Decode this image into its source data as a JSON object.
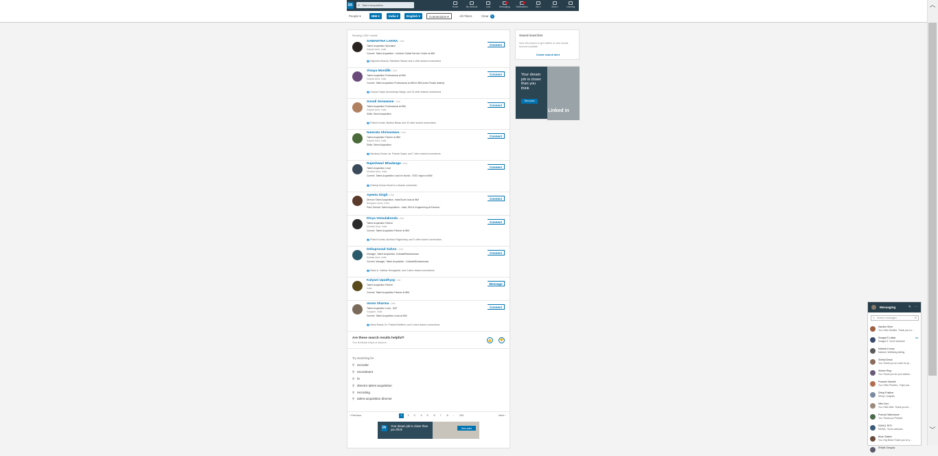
{
  "nav": {
    "logo": "in",
    "search_value": "Talent Acquisition",
    "items": [
      {
        "label": "Home",
        "icon": "home-icon"
      },
      {
        "label": "My Network",
        "icon": "network-icon"
      },
      {
        "label": "Jobs",
        "icon": "jobs-icon"
      },
      {
        "label": "Messaging",
        "icon": "messaging-icon"
      },
      {
        "label": "Notifications",
        "icon": "bell-icon"
      },
      {
        "label": "Me ▾",
        "icon": "avatar-icon"
      },
      {
        "label": "Work ▾",
        "icon": "grid-icon"
      },
      {
        "label": "Learning",
        "icon": "learning-icon"
      }
    ]
  },
  "filters": {
    "people": "People ▾",
    "company": "IBM ▾",
    "location": "India ▾",
    "language": "English ▾",
    "connections": "Connections ▾",
    "all_filters": "All Filters",
    "clear": "Clear",
    "clear_count": "3"
  },
  "results": {
    "showing": "Showing 1,000+ results",
    "items": [
      {
        "name": "SAMANTHA LAKRA",
        "degree": "• 2nd",
        "l1": "Talent Acquisition Specialist",
        "l2": "Kalyani Area, India",
        "l3": "Current: Talent Acquisition - Infotech Global Service Center at IBM",
        "shared": "Rajendra Dhanuk, Rishikesh Rawat, and 4 other shared connections",
        "action": "Connect"
      },
      {
        "name": "Vinaya Mondlik",
        "degree": "• 2nd",
        "l1": "Talent Acquisition Professional at IBM",
        "l2": "Kalyani Area, India",
        "l3": "Current: Talent Acquisition Professional at IBM in IBM (India Private limited)",
        "shared": "Gaurav Gupta, Anushreeya Sahgu, and 14 other shared connections",
        "action": "Connect"
      },
      {
        "name": "Sonali Sonawane",
        "degree": "• 2nd",
        "l1": "Talent Acquisition Professional at IBM",
        "l2": "Kalyani Area, India",
        "l3": "Skills: Talent Acquisition",
        "shared": "Pritesh Kumar, Madhur Bhata, and 30 other shared connections",
        "action": "Connect"
      },
      {
        "name": "Namrata Shrivastava",
        "degree": "• 2nd",
        "l1": "Talent Acquisition Partner at IBM",
        "l2": "Kalyani Area, India",
        "l3": "Skills: Talent Acquisition",
        "shared": "Sandeep Kumar Lal, Pranab Gupta, and 7 other shared connections",
        "action": "Connect"
      },
      {
        "name": "Rajeshwari Bhadange",
        "degree": "• 2nd",
        "l1": "Talent Acquisition Lead",
        "l2": "Mumbai Area, India",
        "l3": "Current: Talent Acquisition Lead for Nordic - ISSC region at IBM",
        "shared": "Dheeraj Kumar Keshri is a shared connection",
        "action": "Connect"
      },
      {
        "name": "Apeeta Singh",
        "degree": "• 2nd",
        "l1": "Director Talent Acquisition, India/South Asia at IBM",
        "l2": "Bengaluru Area, India",
        "l3": "Past: Director Talent Acquisition - India, SEA & Engineering at Ericsson",
        "shared": "",
        "action": "Connect"
      },
      {
        "name": "Divya Vemulakonda",
        "degree": "• 2nd",
        "l1": "Talent Acquisition Partner",
        "l2": "Mumbai Area, India",
        "l3": "Current: Talent Acquisition Partner at IBM",
        "shared": "Pritesh Kumar, Anubhav Rajpurohay, and 9 other shared connections",
        "action": "Connect"
      },
      {
        "name": "Debaprasad Sahoo",
        "degree": "• 2nd",
        "l1": "Manager, Talent Acquisition, Kolkata/Bhubaneswar",
        "l2": "Kolkata Area, India",
        "l3": "Current: Manager, Talent Acquisition - Kolkata/Bhubaneswar",
        "shared": "Rahul A. Vaibhav Nimagadde, and 4 other shared connections",
        "action": "Connect"
      },
      {
        "name": "Kalyani Upadhyay",
        "degree": "• 1st",
        "l1": "Talent Acquisition Partner",
        "l2": "India",
        "l3": "Current: Talent Acquisition Partner at IBM",
        "shared": "",
        "action": "Message"
      },
      {
        "name": "Varun Sharma",
        "degree": "• 2nd",
        "l1": "Talent Acquisition Lead - SAP",
        "l2": "Gurgaon, India",
        "l3": "Current: Talent Acquisition Lead at IBM",
        "shared": "Nisha Rawal, Dr. Prakshit Bahlhmi, and 4 other shared connections",
        "action": "Connect"
      }
    ]
  },
  "helpful": {
    "question": "Are these search results helpful?",
    "subtitle": "Your feedback helps us improve.",
    "thumb_up": "👍",
    "thumb_down": "👎"
  },
  "try_searching": {
    "title": "Try searching for",
    "items": [
      "recruiter",
      "recruitment",
      "hr",
      "director talent acquisition",
      "recruiting",
      "talent acquisition director"
    ]
  },
  "pagination": {
    "previous": "‹ Previous",
    "next": "Next ›",
    "pages": [
      "1",
      "2",
      "3",
      "4",
      "5",
      "6",
      "7",
      "8",
      "…",
      "100"
    ],
    "current": "1"
  },
  "bottom_ad": {
    "logo": "in",
    "text": "Your dream job is closer than you think",
    "button": "See jobs"
  },
  "saved_searches": {
    "title": "Saved searches",
    "description": "Save this search to get notified on new results become available",
    "link": "Create search alert"
  },
  "right_ad": {
    "text": "Your dream job is closer than you think",
    "button": "See jobs",
    "brand": "Linked in"
  },
  "messaging": {
    "title": "Messaging",
    "search_placeholder": "Search messages",
    "conversations": [
      {
        "name": "Sandhe Sheri",
        "preview": "You: Hello Sandhe. Thank you so…",
        "date": ""
      },
      {
        "name": "Swagat S Lalkar",
        "preview": "Swagat S: You're welcome",
        "date": "4/1"
      },
      {
        "name": "Mahesh Kumar",
        "preview": "Mahesh: Wellbeing sibling",
        "date": ""
      },
      {
        "name": "Shilhal Desai",
        "preview": "You: Thank you so much for yo…",
        "date": ""
      },
      {
        "name": "Shirlee Ring",
        "preview": "You: Thank you for your wishes…",
        "date": ""
      },
      {
        "name": "Praveen Kamble",
        "preview": "You: Hello Praveen, I hope you…",
        "date": ""
      },
      {
        "name": "Dhiraj Pratihar",
        "preview": "Dhiraj: Congrats",
        "date": ""
      },
      {
        "name": "Nitin Dom",
        "preview": "You: Hello Nitin. Thank you for…",
        "date": ""
      },
      {
        "name": "Pramod Wakchaure",
        "preview": "You: Thank you Pramod",
        "date": ""
      },
      {
        "name": "RAHUL ROY",
        "preview": "RAHUL: You're welcome",
        "date": ""
      },
      {
        "name": "Brian Stabler",
        "preview": "You: Hey Brian! Thank you for y…",
        "date": ""
      },
      {
        "name": "Shilpik Ganguly",
        "preview": "",
        "date": ""
      }
    ]
  }
}
